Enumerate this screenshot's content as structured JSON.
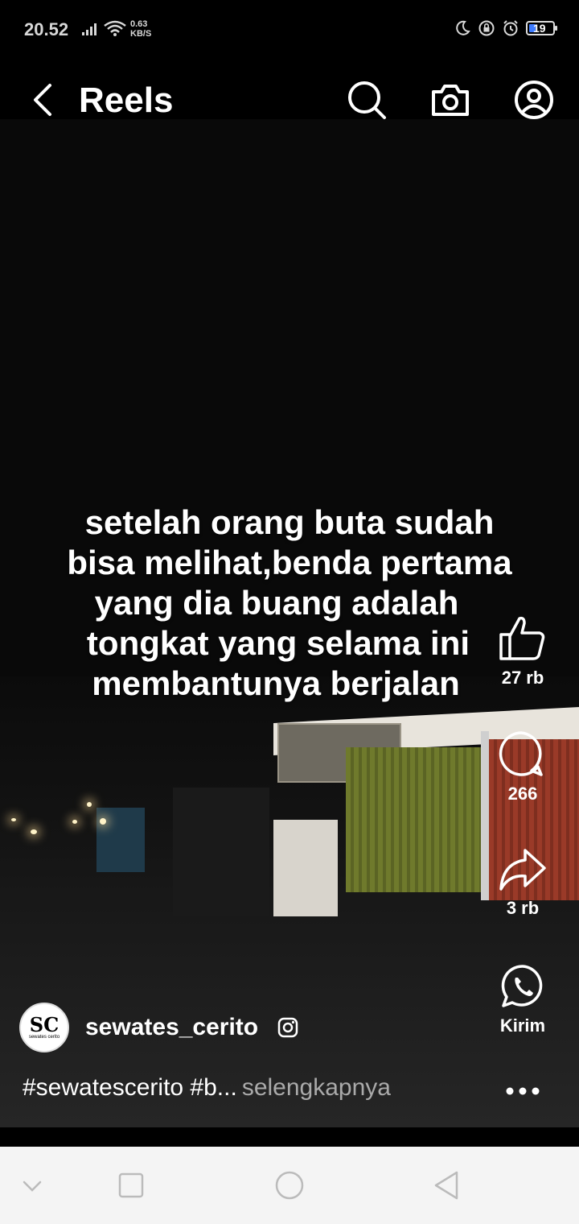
{
  "status_bar": {
    "time": "20.52",
    "net_speed_value": "0.63",
    "net_speed_unit": "KB/S",
    "battery": "19",
    "battery_color": "#3d7bff"
  },
  "header": {
    "title": "Reels",
    "icons": [
      "back-arrow-icon",
      "search-icon",
      "camera-icon",
      "profile-icon"
    ]
  },
  "reel": {
    "caption_lines": [
      "setelah orang buta sudah",
      "bisa melihat,benda pertama",
      "yang dia buang adalah",
      "tongkat yang selama ini",
      "membantunya berjalan"
    ],
    "actions": {
      "like_count": "27 rb",
      "comment_count": "266",
      "share_count": "3 rb",
      "send_label": "Kirim"
    },
    "author": {
      "username": "sewates_cerito",
      "avatar_monogram": "SC",
      "avatar_text": "sewates cerito"
    },
    "description": "#sewatescerito #b...",
    "more_label": "selengkapnya"
  },
  "nav_bar": {
    "icons": [
      "chevron-down-icon",
      "recents-icon",
      "home-icon",
      "back-icon"
    ]
  }
}
